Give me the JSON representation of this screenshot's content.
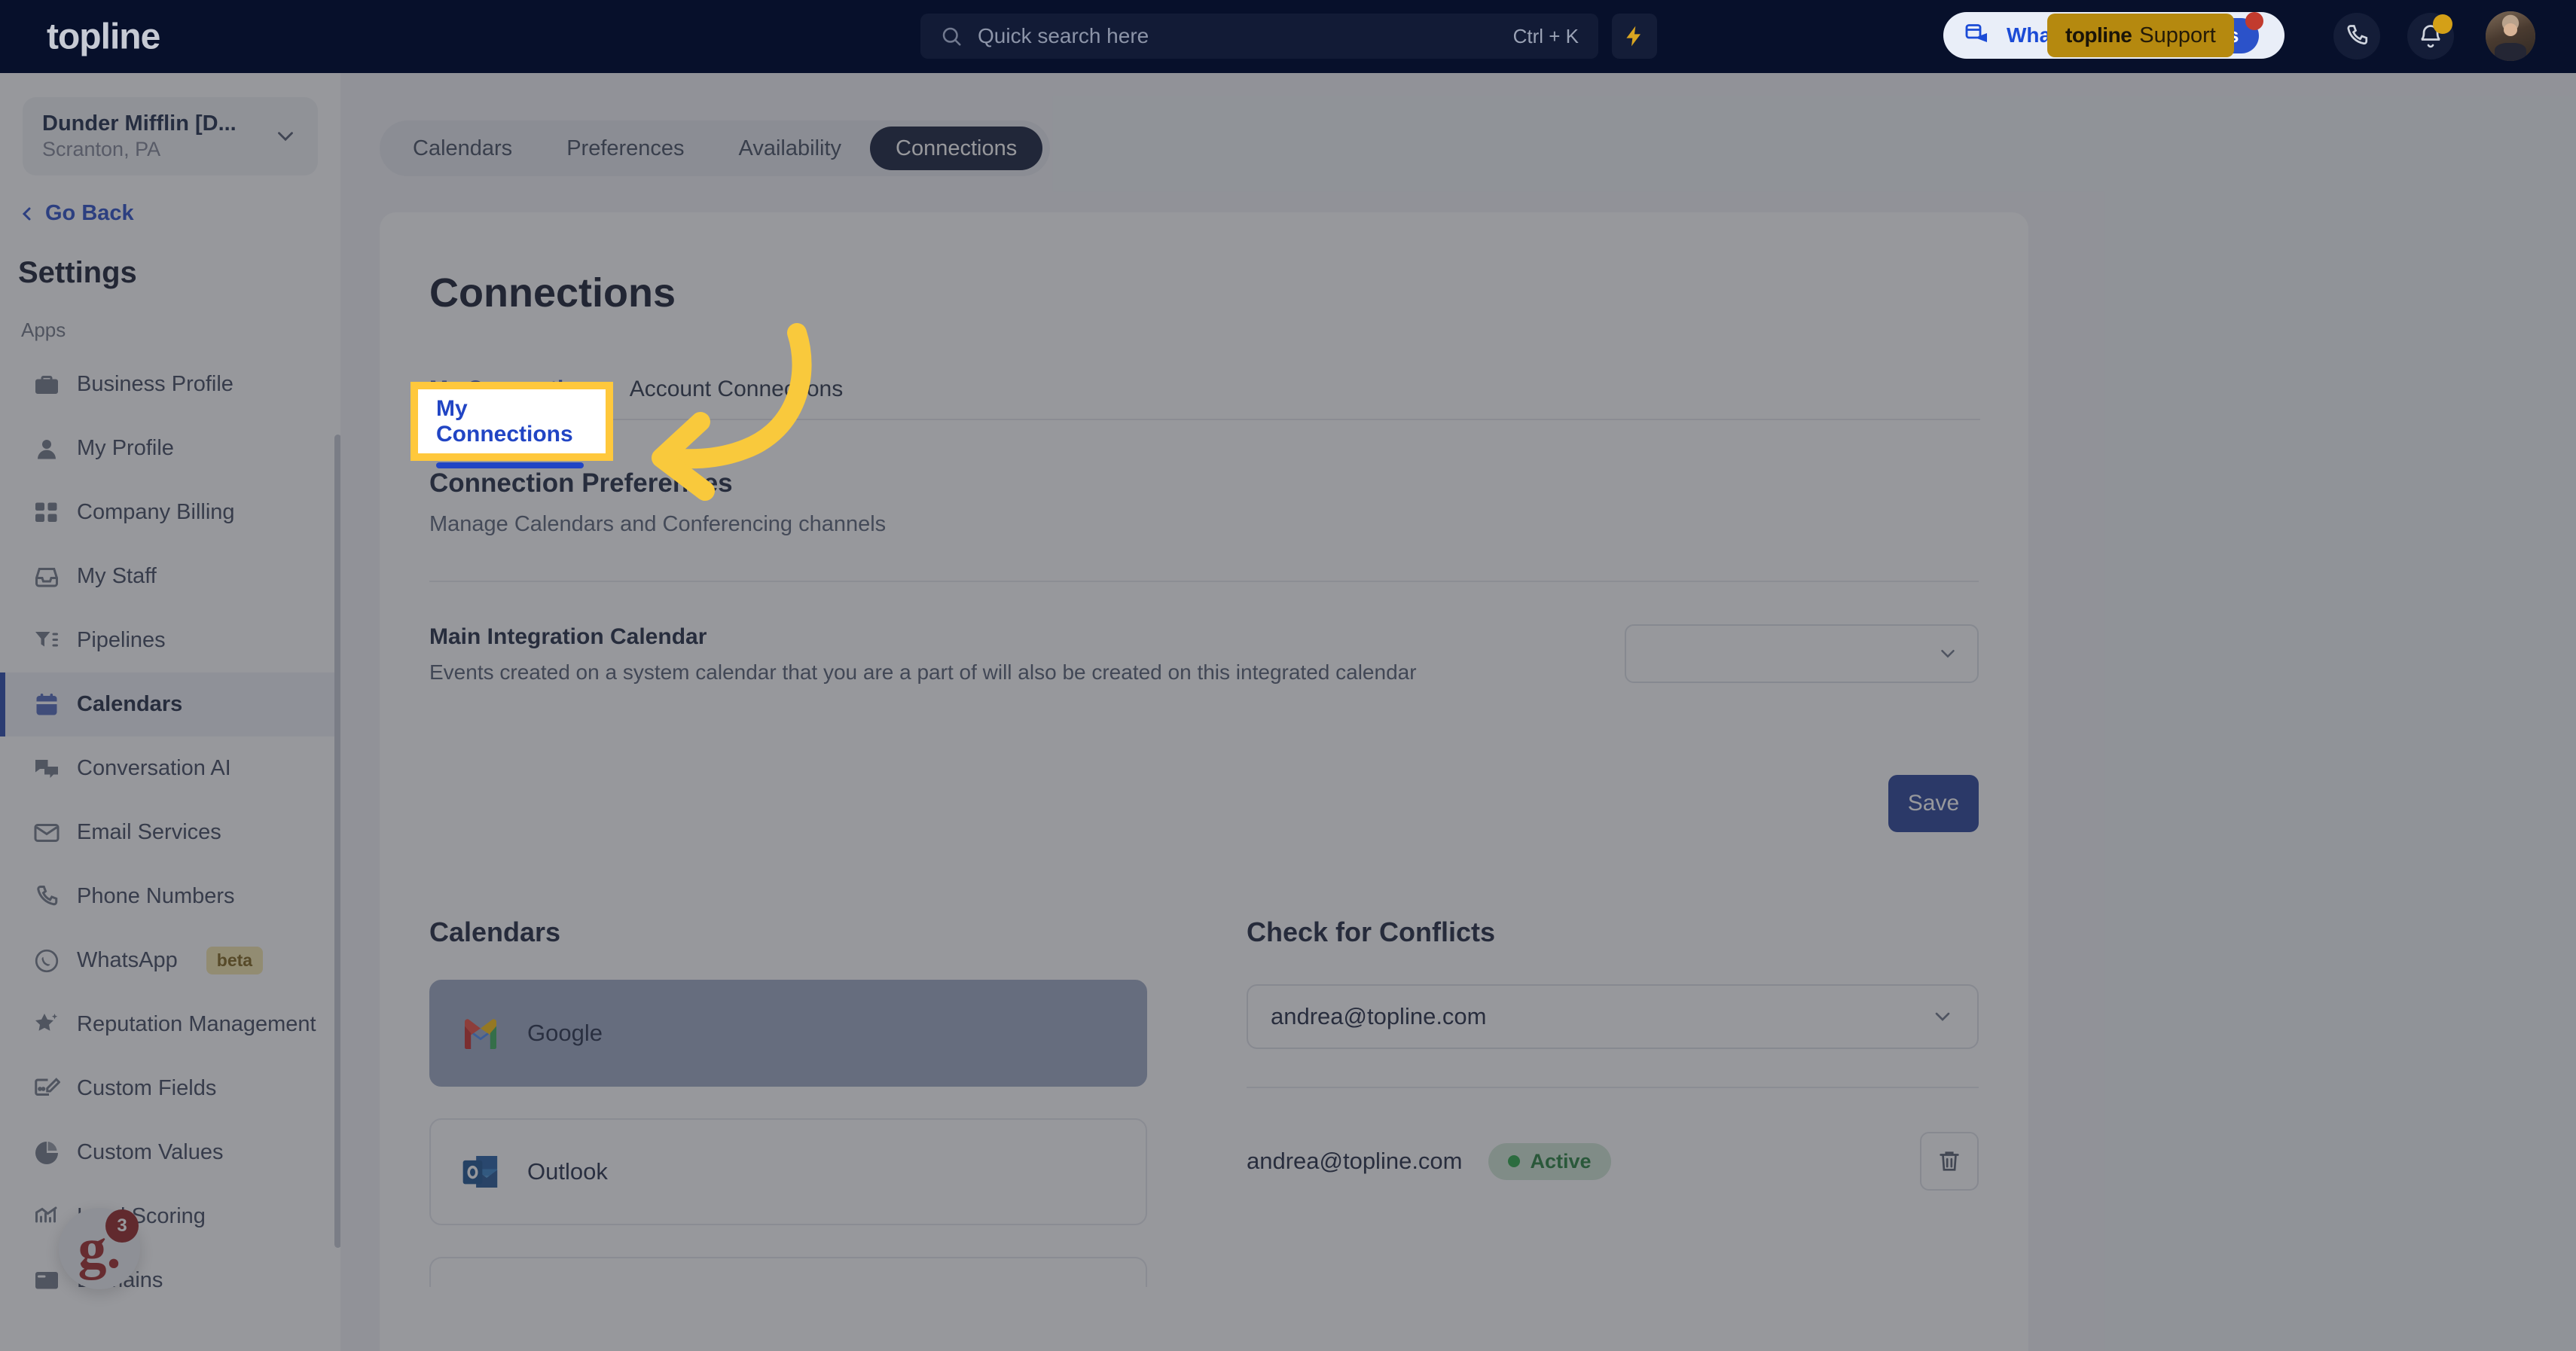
{
  "header": {
    "brand": "topline",
    "search": {
      "placeholder": "Quick search here",
      "shortcut": "Ctrl + K",
      "icon": "search-icon"
    },
    "bolt_icon": "lightning-bolt-icon",
    "whats_new_label": "What's New",
    "updates_label": "Updates",
    "support_tooltip": {
      "brand": "topline",
      "label": "Support"
    },
    "phone_icon": "phone-icon",
    "bell_icon": "bell-icon",
    "avatar": "user-avatar"
  },
  "sidebar": {
    "location": {
      "name": "Dunder Mifflin [D...",
      "sub": "Scranton, PA"
    },
    "go_back": "Go Back",
    "title": "Settings",
    "group_label": "Apps",
    "items": [
      {
        "label": "Business Profile",
        "icon": "briefcase-icon",
        "active": false
      },
      {
        "label": "My Profile",
        "icon": "user-icon",
        "active": false
      },
      {
        "label": "Company Billing",
        "icon": "calculator-icon",
        "active": false
      },
      {
        "label": "My Staff",
        "icon": "inbox-icon",
        "active": false
      },
      {
        "label": "Pipelines",
        "icon": "funnel-icon",
        "active": false
      },
      {
        "label": "Calendars",
        "icon": "calendar-icon",
        "active": true
      },
      {
        "label": "Conversation AI",
        "icon": "chat-bubbles-icon",
        "active": false
      },
      {
        "label": "Email Services",
        "icon": "envelope-icon",
        "active": false
      },
      {
        "label": "Phone Numbers",
        "icon": "phone-icon",
        "active": false
      },
      {
        "label": "WhatsApp",
        "icon": "whatsapp-icon",
        "badge": "beta",
        "active": false
      },
      {
        "label": "Reputation Management",
        "icon": "star-sparkle-icon",
        "active": false
      },
      {
        "label": "Custom Fields",
        "icon": "edit-field-icon",
        "active": false
      },
      {
        "label": "Custom Values",
        "icon": "pie-chart-icon",
        "active": false
      },
      {
        "label": "Lead Scoring",
        "icon": "chart-line-icon",
        "active": false
      },
      {
        "label": "Domains",
        "icon": "browser-window-icon",
        "active": false
      }
    ],
    "support_widget": {
      "glyph": "g.",
      "count": "3"
    }
  },
  "main": {
    "tabs": [
      {
        "label": "Calendars",
        "active": false
      },
      {
        "label": "Preferences",
        "active": false
      },
      {
        "label": "Availability",
        "active": false
      },
      {
        "label": "Connections",
        "active": true
      }
    ],
    "page_title": "Connections",
    "subtabs": [
      {
        "label": "My Connections",
        "active": true
      },
      {
        "label": "Account Connections",
        "active": false
      }
    ],
    "section": {
      "title": "Connection Preferences",
      "subtitle": "Manage Calendars and Conferencing channels"
    },
    "main_integration": {
      "label": "Main Integration Calendar",
      "description": "Events created on a system calendar that you are a part of will also be created on this integrated calendar",
      "value": "",
      "chevron": "chevron-down-icon"
    },
    "save_label": "Save",
    "calendars_panel": {
      "heading": "Calendars",
      "items": [
        {
          "label": "Google",
          "icon": "gmail-icon",
          "selected": true
        },
        {
          "label": "Outlook",
          "icon": "outlook-icon",
          "selected": false
        }
      ]
    },
    "conflicts_panel": {
      "heading": "Check for Conflicts",
      "selected_account": "andrea@topline.com",
      "chevron": "chevron-down-icon",
      "connection": {
        "email": "andrea@topline.com",
        "status": "Active",
        "delete_icon": "trash-icon"
      }
    }
  },
  "annotation": {
    "spotlight_label": "My Connections",
    "highlight_color": "#ffc83c",
    "arrow": "curved-arrow-pointing-left"
  }
}
